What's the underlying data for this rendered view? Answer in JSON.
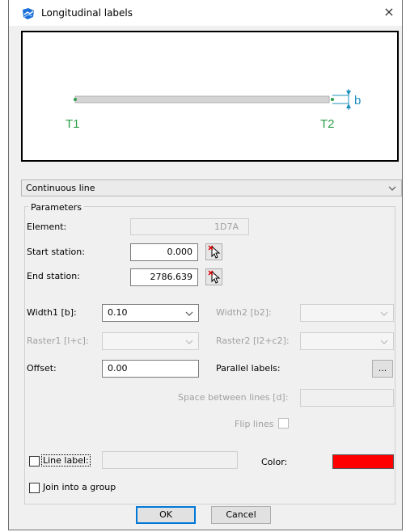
{
  "window": {
    "title": "Longitudinal labels",
    "close_glyph": "×"
  },
  "preview": {
    "start_label": "T1",
    "end_label": "T2",
    "width_label": "b"
  },
  "line_type": {
    "selected": "Continuous line"
  },
  "parameters": {
    "group_title": "Parameters",
    "element": {
      "label": "Element:",
      "value": "1D7A"
    },
    "start_station": {
      "label": "Start station:",
      "value": "0.000"
    },
    "end_station": {
      "label": "End station:",
      "value": "2786.639"
    },
    "width1": {
      "label": "Width1 [b]:",
      "value": "0.10"
    },
    "width2": {
      "label": "Width2 [b2]:",
      "value": ""
    },
    "raster1": {
      "label": "Raster1 [l+c]:",
      "value": ""
    },
    "raster2": {
      "label": "Raster2 [l2+c2]:",
      "value": ""
    },
    "offset": {
      "label": "Offset:",
      "value": "0.00"
    },
    "parallel_labels": {
      "label": "Parallel labels:",
      "button": "..."
    },
    "space_between": {
      "label": "Space between lines [d]:",
      "value": ""
    },
    "flip_lines": {
      "label": "Flip lines"
    },
    "line_label": {
      "label": "Line label:",
      "value": ""
    },
    "color": {
      "label": "Color:",
      "value": "#ff0000"
    },
    "join_group": {
      "label": "Join into a group"
    }
  },
  "buttons": {
    "ok": "OK",
    "cancel": "Cancel"
  },
  "colors": {
    "accent": "#0078d7",
    "preview_point": "#2e9e4a",
    "preview_label": "#1f8fbf",
    "line_color": "#ff0000"
  }
}
